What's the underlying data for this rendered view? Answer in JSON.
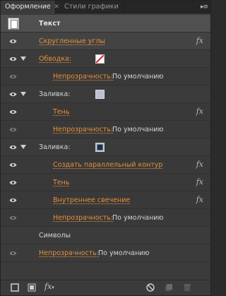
{
  "tabs": [
    {
      "label": "Оформление",
      "active": true
    },
    {
      "label": "Стили графики",
      "active": false
    }
  ],
  "rows": [
    {
      "name": "Текст"
    },
    {
      "link": "Скругленные углы",
      "fx": "fx"
    },
    {
      "link": "Обводка:"
    },
    {
      "link": "Непрозрачность:",
      "value": "По умолчанию"
    },
    {
      "label": "Заливка:"
    },
    {
      "link": "Тень",
      "fx": "fx"
    },
    {
      "link": "Непрозрачность:",
      "value": "По умолчанию"
    },
    {
      "label": "Заливка:"
    },
    {
      "link": "Создать параллельный контур",
      "fx": "fx"
    },
    {
      "link": "Тень",
      "fx": "fx"
    },
    {
      "link": "Внутреннее свечение",
      "fx": "fx"
    },
    {
      "link": "Непрозрачность:",
      "value": "По умолчанию"
    },
    {
      "label": "Символы"
    },
    {
      "link": "Непрозрачность:",
      "value": "По умолчанию"
    }
  ],
  "toolbar": {
    "fx_label": "fx"
  },
  "colors": {
    "link": "#e8903a",
    "panel": "#3b3b3b",
    "stroke_swatch_slash": "#d81e2a",
    "fill1": "#bcc0d4",
    "fill2": "#203040"
  },
  "icons": [
    "eye-icon",
    "disclosure-triangle-icon",
    "new-stroke-icon",
    "new-fill-icon",
    "fx-menu-icon",
    "clear-appearance-icon",
    "duplicate-icon",
    "delete-icon"
  ]
}
